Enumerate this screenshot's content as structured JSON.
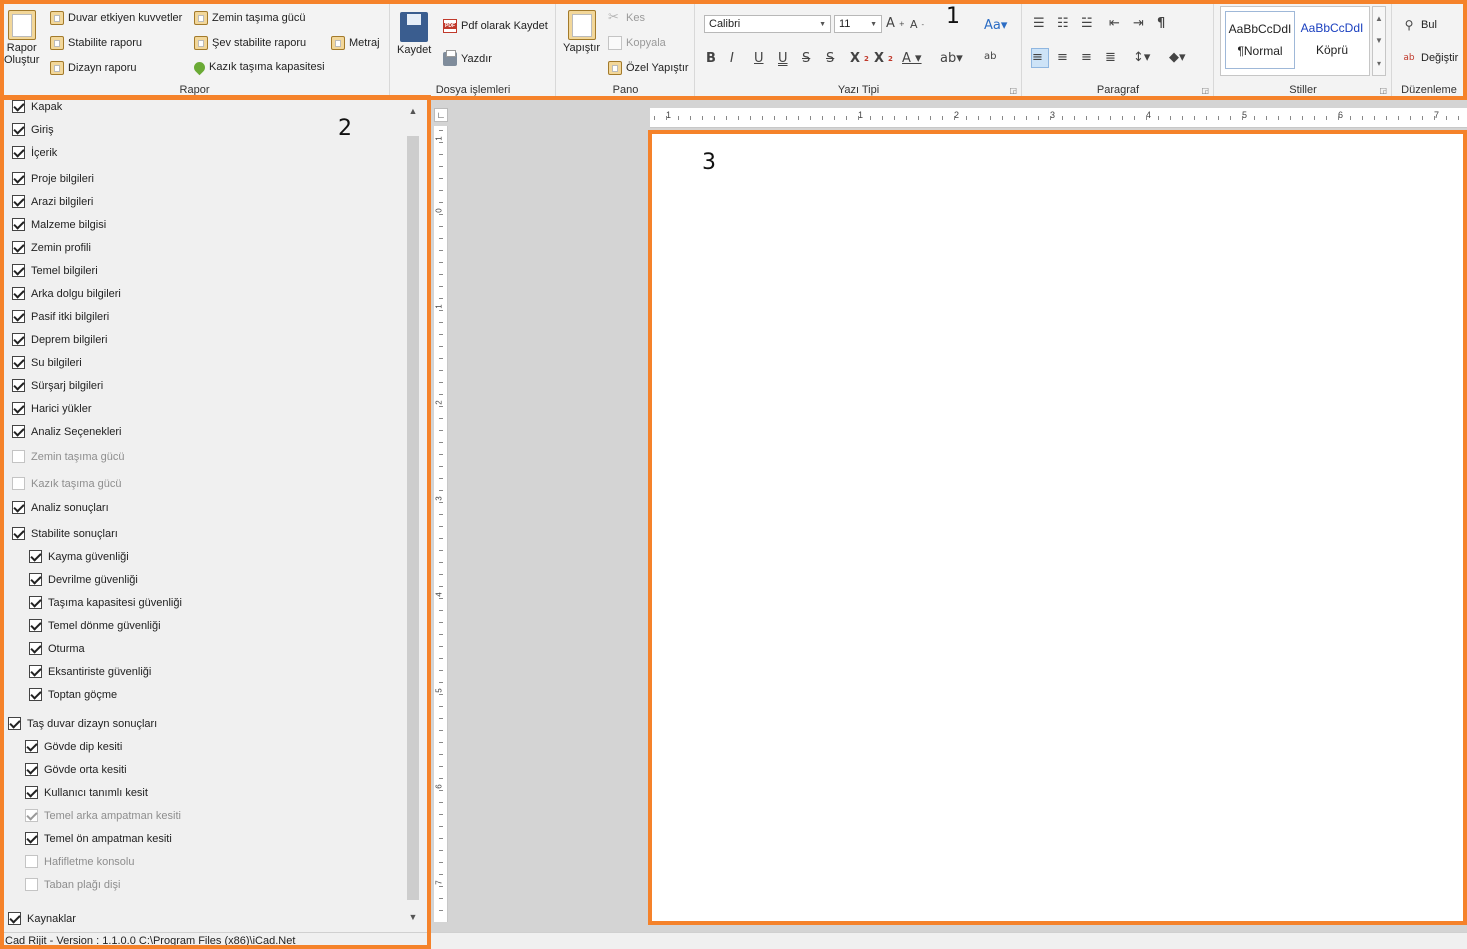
{
  "ribbon": {
    "rapor": {
      "group_label": "Rapor",
      "create_label_1": "Rapor",
      "create_label_2": "Oluştur",
      "items": [
        "Duvar etkiyen kuvvetler",
        "Stabilite raporu",
        "Dizayn raporu",
        "Zemin taşıma gücü",
        "Şev stabilite raporu",
        "Kazık taşıma kapasitesi",
        "Metraj"
      ]
    },
    "dosya": {
      "group_label": "Dosya işlemleri",
      "save_label": "Kaydet",
      "pdf_label": "Pdf olarak Kaydet",
      "print_label": "Yazdır"
    },
    "pano": {
      "group_label": "Pano",
      "paste_label": "Yapıştır",
      "cut_label": "Kes",
      "copy_label": "Kopyala",
      "special_paste_label": "Özel Yapıştır"
    },
    "font": {
      "group_label": "Yazı Tipi",
      "font_name": "Calibri",
      "font_size": "11"
    },
    "paragraph": {
      "group_label": "Paragraf"
    },
    "styles": {
      "group_label": "Stiller",
      "normal_sample": "AaBbCcDdI",
      "normal_name": "¶Normal",
      "link_sample": "AaBbCcDdI",
      "link_name": "Köprü"
    },
    "editing": {
      "group_label": "Düzenleme",
      "find_label": "Bul",
      "replace_label": "Değiştir"
    }
  },
  "tree": {
    "items": [
      {
        "label": "Kapak",
        "checked": true,
        "disabled": false,
        "indent": 0
      },
      {
        "label": "Giriş",
        "checked": true,
        "disabled": false,
        "indent": 0
      },
      {
        "label": "İçerik",
        "checked": true,
        "disabled": false,
        "indent": 0
      },
      {
        "label": "Proje bilgileri",
        "checked": true,
        "disabled": false,
        "indent": 0
      },
      {
        "label": "Arazi bilgileri",
        "checked": true,
        "disabled": false,
        "indent": 0
      },
      {
        "label": "Malzeme bilgisi",
        "checked": true,
        "disabled": false,
        "indent": 0
      },
      {
        "label": "Zemin profili",
        "checked": true,
        "disabled": false,
        "indent": 0
      },
      {
        "label": "Temel bilgileri",
        "checked": true,
        "disabled": false,
        "indent": 0
      },
      {
        "label": "Arka dolgu bilgileri",
        "checked": true,
        "disabled": false,
        "indent": 0
      },
      {
        "label": "Pasif itki bilgileri",
        "checked": true,
        "disabled": false,
        "indent": 0
      },
      {
        "label": "Deprem bilgileri",
        "checked": true,
        "disabled": false,
        "indent": 0
      },
      {
        "label": "Su bilgileri",
        "checked": true,
        "disabled": false,
        "indent": 0
      },
      {
        "label": "Sürşarj bilgileri",
        "checked": true,
        "disabled": false,
        "indent": 0
      },
      {
        "label": "Harici yükler",
        "checked": true,
        "disabled": false,
        "indent": 0
      },
      {
        "label": "Analiz Seçenekleri",
        "checked": true,
        "disabled": false,
        "indent": 0
      },
      {
        "label": "Zemin taşıma gücü",
        "checked": false,
        "disabled": true,
        "indent": 0
      },
      {
        "label": "Kazık taşıma gücü",
        "checked": false,
        "disabled": true,
        "indent": 0
      },
      {
        "label": "Analiz sonuçları",
        "checked": true,
        "disabled": false,
        "indent": 0
      },
      {
        "label": "Stabilite sonuçları",
        "checked": true,
        "disabled": false,
        "indent": 0
      },
      {
        "label": "Kayma güvenliği",
        "checked": true,
        "disabled": false,
        "indent": 2
      },
      {
        "label": "Devrilme güvenliği",
        "checked": true,
        "disabled": false,
        "indent": 2
      },
      {
        "label": "Taşıma kapasitesi güvenliği",
        "checked": true,
        "disabled": false,
        "indent": 2
      },
      {
        "label": "Temel dönme güvenliği",
        "checked": true,
        "disabled": false,
        "indent": 2
      },
      {
        "label": "Oturma",
        "checked": true,
        "disabled": false,
        "indent": 2
      },
      {
        "label": "Eksantiriste güvenliği",
        "checked": true,
        "disabled": false,
        "indent": 2
      },
      {
        "label": "Toptan göçme",
        "checked": true,
        "disabled": false,
        "indent": 2
      },
      {
        "label": "Taş duvar dizayn sonuçları",
        "checked": true,
        "disabled": false,
        "indent": -1
      },
      {
        "label": "Gövde dip kesiti",
        "checked": true,
        "disabled": false,
        "indent": 1
      },
      {
        "label": "Gövde orta kesiti",
        "checked": true,
        "disabled": false,
        "indent": 1
      },
      {
        "label": "Kullanıcı tanımlı kesit",
        "checked": true,
        "disabled": false,
        "indent": 1
      },
      {
        "label": "Temel arka ampatman kesiti",
        "checked": true,
        "disabled": true,
        "indent": 1
      },
      {
        "label": "Temel ön ampatman kesiti",
        "checked": true,
        "disabled": false,
        "indent": 1
      },
      {
        "label": "Hafifletme konsolu",
        "checked": false,
        "disabled": true,
        "indent": 1
      },
      {
        "label": "Taban plağı dişi",
        "checked": false,
        "disabled": true,
        "indent": 1
      },
      {
        "label": "Kaynaklar",
        "checked": true,
        "disabled": false,
        "indent": -1
      }
    ]
  },
  "status": {
    "text": "Cad Rijit - Version : 1.1.0.0   C:\\Program Files (x86)\\iCad.Net"
  },
  "ruler": {
    "h_numbers": [
      "1",
      "1",
      "2",
      "3",
      "4",
      "5",
      "6",
      "7"
    ],
    "v_numbers": [
      "1",
      "0",
      "1",
      "2",
      "3",
      "4",
      "5",
      "6",
      "7"
    ]
  },
  "annotations": [
    "1",
    "2",
    "3"
  ],
  "colors": {
    "annotation": "#f5822a",
    "ribbon_bg": "#f3f3f3",
    "page_bg": "#ffffff",
    "editor_bg": "#d4d4d4"
  }
}
